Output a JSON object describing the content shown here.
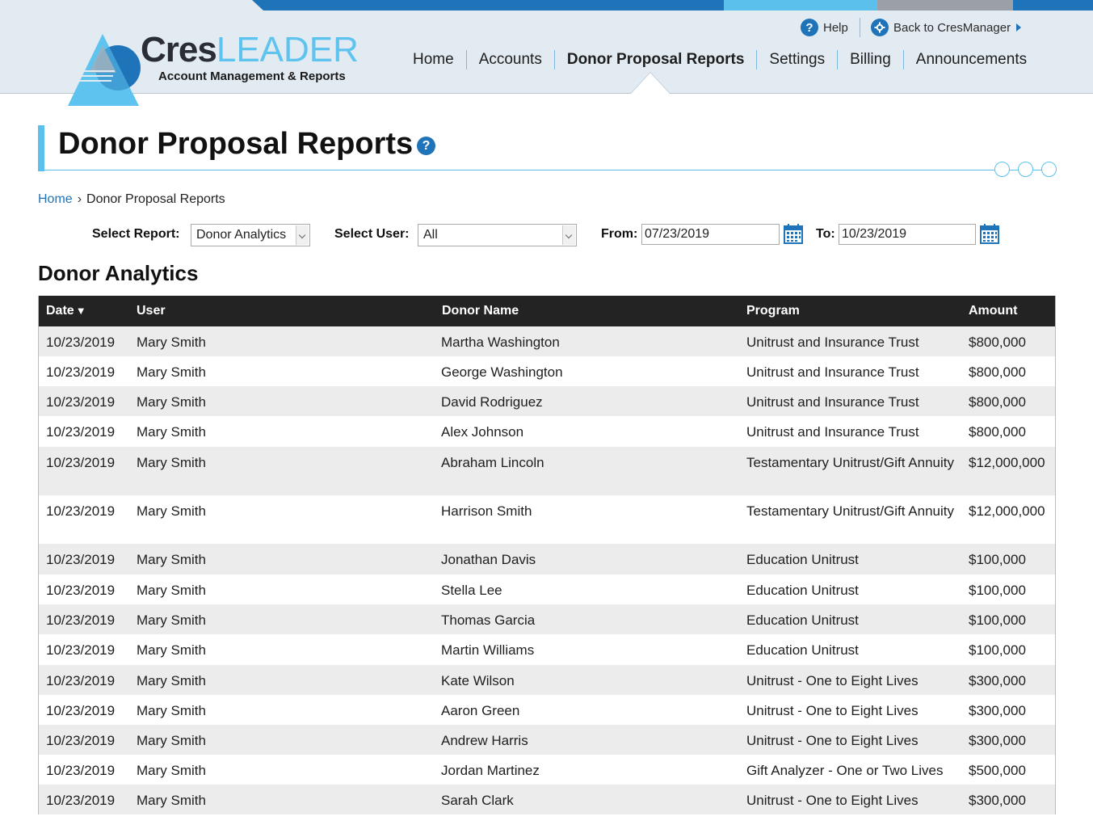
{
  "header": {
    "logo": {
      "primary": "Cres",
      "secondary": "LEADER",
      "subtitle": "Account Management & Reports"
    },
    "utility": {
      "help": "Help",
      "back": "Back to CresManager"
    },
    "nav": [
      "Home",
      "Accounts",
      "Donor Proposal Reports",
      "Settings",
      "Billing",
      "Announcements"
    ],
    "active_nav": "Donor Proposal Reports",
    "colors": {
      "brand_blue": "#1f74b9",
      "accent_light_blue": "#5cc0ec",
      "header_bg": "#e3ebf2"
    }
  },
  "page": {
    "title": "Donor Proposal Reports"
  },
  "breadcrumb": {
    "home": "Home",
    "separator": "›",
    "current": "Donor Proposal Reports"
  },
  "filters": {
    "report_label": "Select Report:",
    "report_value": "Donor Analytics",
    "user_label": "Select User:",
    "user_value": "All",
    "from_label": "From:",
    "from_value": "07/23/2019",
    "to_label": "To:",
    "to_value": "10/23/2019"
  },
  "section": {
    "title": "Donor Analytics"
  },
  "table": {
    "headers": {
      "date": "Date",
      "sort_indicator": "▼",
      "user": "User",
      "donor": "Donor Name",
      "program": "Program",
      "amount": "Amount"
    },
    "rows": [
      {
        "date": "10/23/2019",
        "user": "Mary Smith",
        "donor": "Martha Washington",
        "program": "Unitrust and Insurance Trust",
        "amount": "$800,000"
      },
      {
        "date": "10/23/2019",
        "user": "Mary Smith",
        "donor": "George Washington",
        "program": "Unitrust and Insurance Trust",
        "amount": "$800,000"
      },
      {
        "date": "10/23/2019",
        "user": "Mary Smith",
        "donor": "David Rodriguez",
        "program": "Unitrust and Insurance Trust",
        "amount": "$800,000"
      },
      {
        "date": "10/23/2019",
        "user": "Mary Smith",
        "donor": "Alex Johnson",
        "program": "Unitrust and Insurance Trust",
        "amount": "$800,000"
      },
      {
        "date": "10/23/2019",
        "user": "Mary Smith",
        "donor": "Abraham Lincoln",
        "program": "Testamentary Unitrust/Gift Annuity",
        "amount": "$12,000,000"
      },
      {
        "date": "10/23/2019",
        "user": "Mary Smith",
        "donor": "Harrison Smith",
        "program": "Testamentary Unitrust/Gift Annuity",
        "amount": "$12,000,000"
      },
      {
        "date": "10/23/2019",
        "user": "Mary Smith",
        "donor": "Jonathan Davis",
        "program": "Education Unitrust",
        "amount": "$100,000"
      },
      {
        "date": "10/23/2019",
        "user": "Mary Smith",
        "donor": "Stella Lee",
        "program": "Education Unitrust",
        "amount": "$100,000"
      },
      {
        "date": "10/23/2019",
        "user": "Mary Smith",
        "donor": "Thomas Garcia",
        "program": "Education Unitrust",
        "amount": "$100,000"
      },
      {
        "date": "10/23/2019",
        "user": "Mary Smith",
        "donor": "Martin Williams",
        "program": "Education Unitrust",
        "amount": "$100,000"
      },
      {
        "date": "10/23/2019",
        "user": "Mary Smith",
        "donor": "Kate Wilson",
        "program": "Unitrust - One to Eight Lives",
        "amount": "$300,000"
      },
      {
        "date": "10/23/2019",
        "user": "Mary Smith",
        "donor": "Aaron Green",
        "program": "Unitrust - One to Eight Lives",
        "amount": "$300,000"
      },
      {
        "date": "10/23/2019",
        "user": "Mary Smith",
        "donor": "Andrew Harris",
        "program": "Unitrust - One to Eight Lives",
        "amount": "$300,000"
      },
      {
        "date": "10/23/2019",
        "user": "Mary Smith",
        "donor": "Jordan Martinez",
        "program": "Gift Analyzer - One or Two Lives",
        "amount": "$500,000"
      },
      {
        "date": "10/23/2019",
        "user": "Mary Smith",
        "donor": "Sarah Clark",
        "program": "Unitrust - One to Eight Lives",
        "amount": "$300,000"
      }
    ]
  }
}
